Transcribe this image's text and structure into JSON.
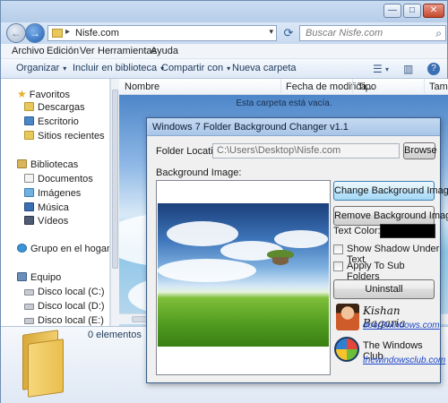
{
  "titlebar": {
    "minimize_glyph": "—",
    "maximize_glyph": "□",
    "close_glyph": "✕"
  },
  "nav": {
    "back_glyph": "←",
    "forward_glyph": "→",
    "address_separator": "▸",
    "address_value": "Nisfe.com",
    "address_dropdown_glyph": "▾",
    "refresh_glyph": "⟳",
    "search_placeholder": "Buscar Nisfe.com",
    "search_glyph": "⌕"
  },
  "menubar": [
    "Archivo",
    "Edición",
    "Ver",
    "Herramientas",
    "Ayuda"
  ],
  "cmdbar": {
    "organize": "Organizar",
    "include": "Incluir en biblioteca",
    "share": "Compartir con",
    "new_folder": "Nueva carpeta",
    "dropdown_glyph": "▾",
    "view_glyph": "☰",
    "preview_glyph": "▥",
    "help_glyph": "?"
  },
  "sidebar": {
    "star_glyph": "★",
    "favorites": "Favoritos",
    "downloads": "Descargas",
    "desktop": "Escritorio",
    "recent": "Sitios recientes",
    "libraries": "Bibliotecas",
    "documents": "Documentos",
    "pictures": "Imágenes",
    "music": "Música",
    "videos": "Vídeos",
    "homegroup": "Grupo en el hogar",
    "computer": "Equipo",
    "disk_c": "Disco local (C:)",
    "disk_d": "Disco local (D:)",
    "disk_e": "Disco local (E:)"
  },
  "columns": {
    "name": "Nombre",
    "date": "Fecha de modifica...",
    "type": "Tipo",
    "size": "Tam"
  },
  "content": {
    "empty_message": "Esta carpeta está vacía."
  },
  "details": {
    "item_count": "0 elementos"
  },
  "dialog": {
    "title": "Windows 7 Folder Background Changer v1.1",
    "folder_location_label": "Folder Location:",
    "folder_location_value": "C:\\Users\\Desktop\\Nisfe.com",
    "browse_button": "Browse",
    "background_image_label": "Background Image:",
    "change_bg_button": "Change Background Image",
    "remove_bg_button": "Remove Background Image",
    "text_color_label": "Text Color:",
    "text_color_value": "#000000",
    "show_shadow_label": "Show Shadow Under Text",
    "apply_sub_label": "Apply To Sub Folders",
    "uninstall_button": "Uninstall",
    "author_name": "Kishan Bagaria",
    "author_link": "door2windows.com",
    "club_name": "The Windows Club",
    "club_link": "thewindowsclub.com"
  }
}
